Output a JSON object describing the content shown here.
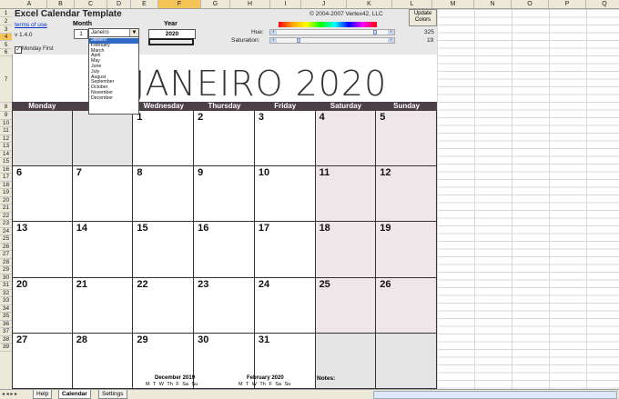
{
  "columns": [
    "A",
    "B",
    "C",
    "D",
    "E",
    "F",
    "G",
    "H",
    "I",
    "J",
    "K",
    "L",
    "M",
    "N",
    "O",
    "P",
    "Q"
  ],
  "selected_column": "F",
  "rows": [
    "1",
    "2",
    "3",
    "4",
    "5",
    "6",
    "7",
    "8",
    "9",
    "10",
    "11",
    "12",
    "13",
    "14",
    "15",
    "16",
    "17",
    "18",
    "19",
    "20",
    "21",
    "22",
    "23",
    "24",
    "25",
    "26",
    "27",
    "28",
    "29",
    "30",
    "31",
    "32",
    "33",
    "34",
    "35",
    "36",
    "37",
    "38",
    "39"
  ],
  "selected_row": "4",
  "header": {
    "title": "Excel Calendar Template",
    "copyright": "© 2004-2007 Vertex42, LLC",
    "terms_link": "terms of use",
    "version": "v 1.4.0",
    "month_label": "Month",
    "month_value": "1",
    "month_select": "Janeiro",
    "year_label": "Year",
    "year_value": "2020",
    "hue_label": "Hue:",
    "hue_value": "325",
    "saturation_label": "Saturation:",
    "saturation_value": "19",
    "hue_position": 0.9,
    "saturation_position": 0.19,
    "update_button": "Update Colors",
    "monday_first_label": "Monday First",
    "monday_first_checked": true
  },
  "dropdown_options": [
    "Janeiro",
    "February",
    "March",
    "April",
    "May",
    "June",
    "July",
    "August",
    "September",
    "October",
    "November",
    "December"
  ],
  "calendar": {
    "title": "JANEIRO 2020",
    "day_names": [
      "Monday",
      "Tuesday",
      "Wednesday",
      "Thursday",
      "Friday",
      "Saturday",
      "Sunday"
    ],
    "weeks": [
      [
        "",
        "",
        "1",
        "2",
        "3",
        "4",
        "5"
      ],
      [
        "6",
        "7",
        "8",
        "9",
        "10",
        "11",
        "12"
      ],
      [
        "13",
        "14",
        "15",
        "16",
        "17",
        "18",
        "19"
      ],
      [
        "20",
        "21",
        "22",
        "23",
        "24",
        "25",
        "26"
      ],
      [
        "27",
        "28",
        "29",
        "30",
        "31",
        "",
        ""
      ]
    ],
    "mini_prev": {
      "title": "December 2019",
      "days": "M T W Th F Sa Su"
    },
    "mini_next": {
      "title": "February 2020",
      "days": "M T W Th F Sa Su"
    },
    "notes_label": "Notes:"
  },
  "sheet_tabs": [
    {
      "label": "Help",
      "active": false
    },
    {
      "label": "Calendar",
      "active": true
    },
    {
      "label": "Settings",
      "active": false
    }
  ],
  "colors": {
    "dayhead": "#4d3f47",
    "weekend": "#efe6ea",
    "outside": "#e4e4e4",
    "selection": "#f6c356"
  }
}
